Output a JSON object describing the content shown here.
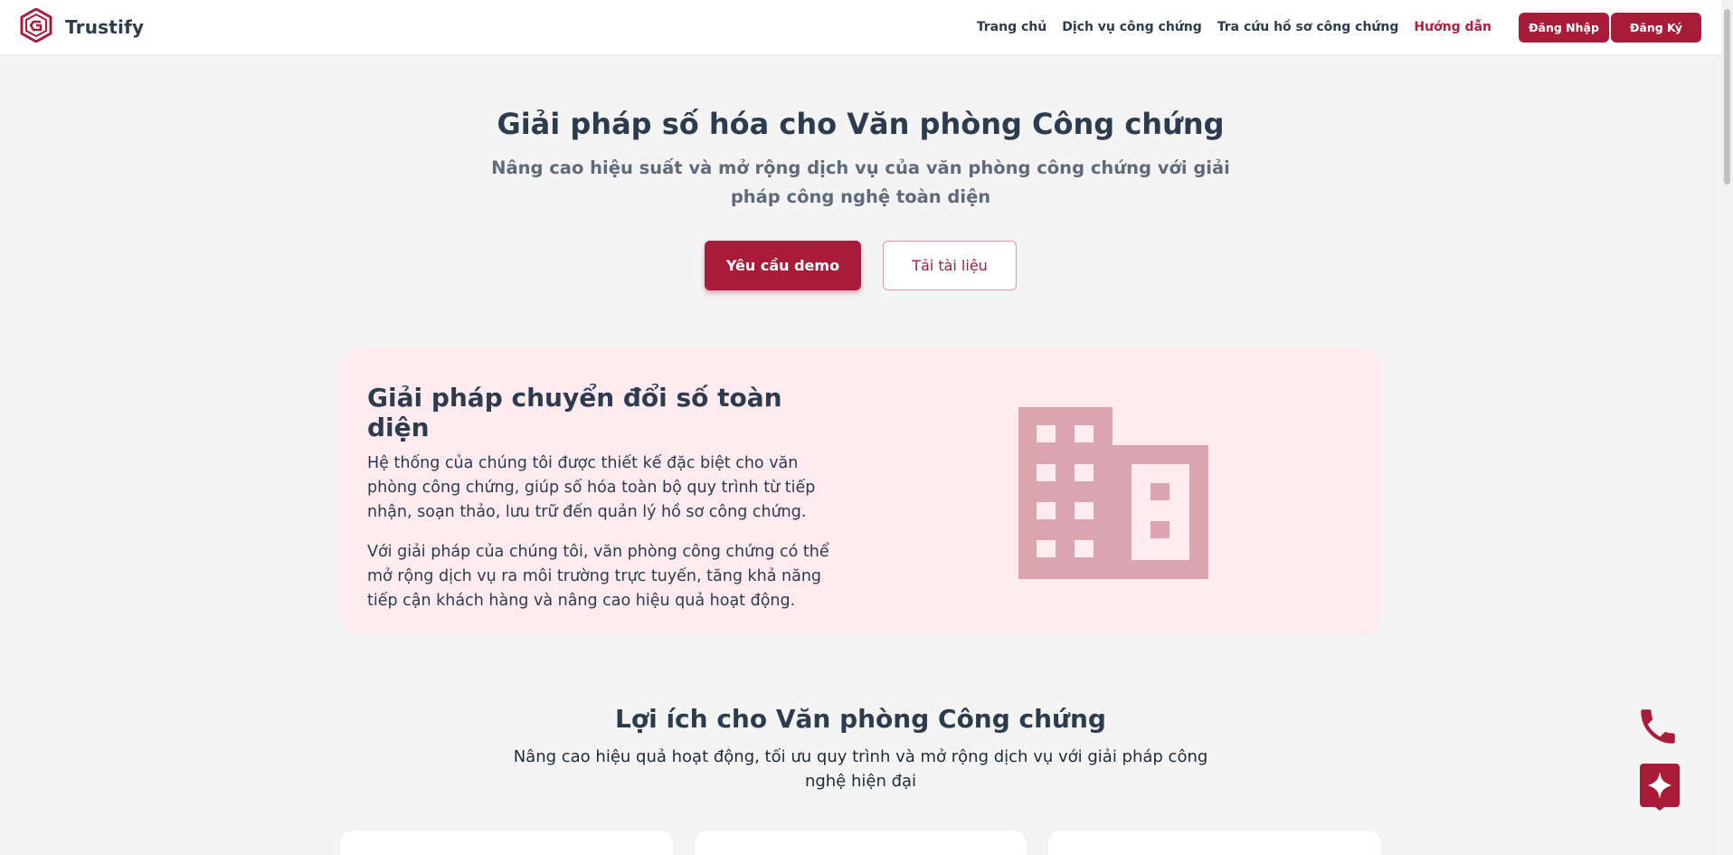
{
  "brand": {
    "name": "Trustify",
    "logo_icon": "trustify-logo-icon"
  },
  "nav": {
    "items": [
      {
        "label": "Trang chủ",
        "active": false
      },
      {
        "label": "Dịch vụ công chứng",
        "active": false
      },
      {
        "label": "Tra cứu hồ sơ công chứng",
        "active": false
      },
      {
        "label": "Hướng dẫn",
        "active": true
      }
    ],
    "login_label": "Đăng Nhập",
    "register_label": "Đăng Ký"
  },
  "hero": {
    "title": "Giải pháp số hóa cho Văn phòng Công chứng",
    "subtitle": "Nâng cao hiệu suất và mở rộng dịch vụ của văn phòng công chứng với giải pháp công nghệ toàn diện",
    "primary_label": "Yêu cầu demo",
    "secondary_label": "Tải tài liệu"
  },
  "feature": {
    "title": "Giải pháp chuyển đổi số toàn diện",
    "paragraph1": "Hệ thống của chúng tôi được thiết kế đặc biệt cho văn phòng công chứng, giúp số hóa toàn bộ quy trình từ tiếp nhận, soạn thảo, lưu trữ đến quản lý hồ sơ công chứng.",
    "paragraph2": "Với giải pháp của chúng tôi, văn phòng công chứng có thể mở rộng dịch vụ ra môi trường trực tuyến, tăng khả năng tiếp cận khách hàng và nâng cao hiệu quả hoạt động.",
    "icon": "building-icon"
  },
  "benefits": {
    "title": "Lợi ích cho Văn phòng Công chứng",
    "subtitle": "Nâng cao hiệu quả hoạt động, tối ưu quy trình và mở rộng dịch vụ với giải pháp công nghệ hiện đại"
  },
  "floating": {
    "phone_icon": "phone-icon",
    "ai_icon": "sparkle-chat-icon"
  },
  "colors": {
    "brand": "#a81c3a",
    "feature_bg": "#fdebef",
    "building": "#dba5b0",
    "text": "#2d3b4e"
  }
}
